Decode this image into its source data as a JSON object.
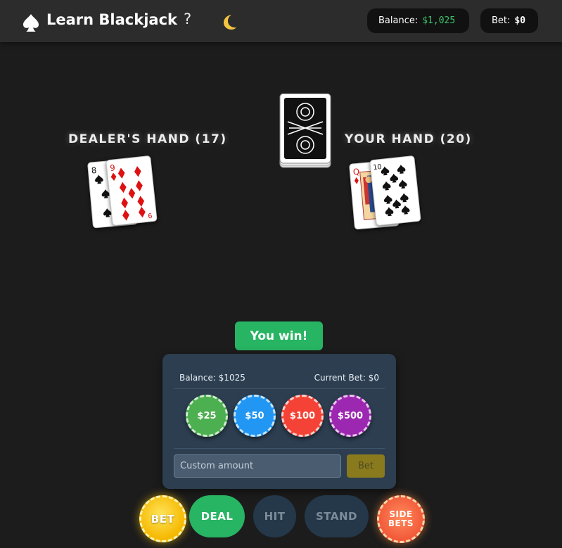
{
  "header": {
    "logo_icon": "spade-icon",
    "title": "Learn Blackjack",
    "help_label": "?",
    "theme_icon": "moon-icon",
    "balance_label": "Balance:",
    "balance_value": "$1,025",
    "bet_label": "Bet:",
    "bet_value": "$0"
  },
  "table": {
    "dealer_title": "DEALER'S HAND (17)",
    "player_title": "YOUR HAND (20)",
    "dealer_cards": [
      {
        "rank": "8",
        "suit": "spades"
      },
      {
        "rank": "9",
        "suit": "diamonds"
      }
    ],
    "player_cards": [
      {
        "rank": "Q",
        "suit": "diamonds"
      },
      {
        "rank": "10",
        "suit": "spades"
      }
    ],
    "deck_icon": "card-back-deck"
  },
  "result": "You win!",
  "betting": {
    "balance": "Balance: $1025",
    "current_bet": "Current Bet: $0",
    "chips": [
      {
        "label": "$25",
        "color": "#4caf50"
      },
      {
        "label": "$50",
        "color": "#2196f3"
      },
      {
        "label": "$100",
        "color": "#f44336"
      },
      {
        "label": "$500",
        "color": "#9c27b0"
      }
    ],
    "custom_placeholder": "Custom amount",
    "bet_button": "Bet"
  },
  "actions": {
    "bet": "BET",
    "deal": "DEAL",
    "hit": "HIT",
    "stand": "STAND",
    "side_bets_line1": "SIDE",
    "side_bets_line2": "BETS"
  },
  "colors": {
    "balance_green": "#3ec46d",
    "win_green": "#27b463",
    "panel_bg": "#2c3e50"
  }
}
